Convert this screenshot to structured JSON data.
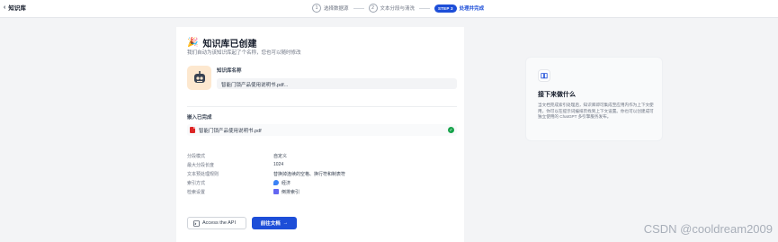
{
  "header": {
    "back_label": "知识库",
    "steps": [
      {
        "num": "1",
        "label": "选择数据源"
      },
      {
        "num": "2",
        "label": "文本分段与清洗"
      },
      {
        "pill": "STEP 3",
        "label": "处理并完成"
      }
    ]
  },
  "main": {
    "title": "知识库已创建",
    "subtitle": "我们自动为该知识库起了个名称，您也可以随时修改",
    "kb_name_label": "知识库名称",
    "kb_name_value": "智能门锁产品使用说明书.pdf...",
    "embed_label": "嵌入已完成",
    "file_name": "智能门锁产品使用说明书.pdf",
    "settings": [
      {
        "key": "分段模式",
        "value": "自定义"
      },
      {
        "key": "最大分段长度",
        "value": "1024"
      },
      {
        "key": "文本预处理规则",
        "value": "替换掉连续的空格、换行符和制表符"
      },
      {
        "key": "索引方式",
        "value": "经济",
        "icon": "economy-icon"
      },
      {
        "key": "检索设置",
        "value": "倒排索引",
        "icon": "inverted-index-icon"
      }
    ],
    "api_button": "Access the API",
    "go_button": "前往文档"
  },
  "info_card": {
    "title": "接下来做什么",
    "text": "当文档完成索引处理后，知识库即可集成至应用内作为上下文使用，你可以在提示词编排页找到上下文设置。你也可以创建成可独立使用的 ChatGPT 多引擎服务发布。"
  },
  "watermark": "CSDN @cooldream2009",
  "colors": {
    "accent": "#1d4ed8",
    "success": "#16a34a",
    "file": "#dc2626"
  }
}
